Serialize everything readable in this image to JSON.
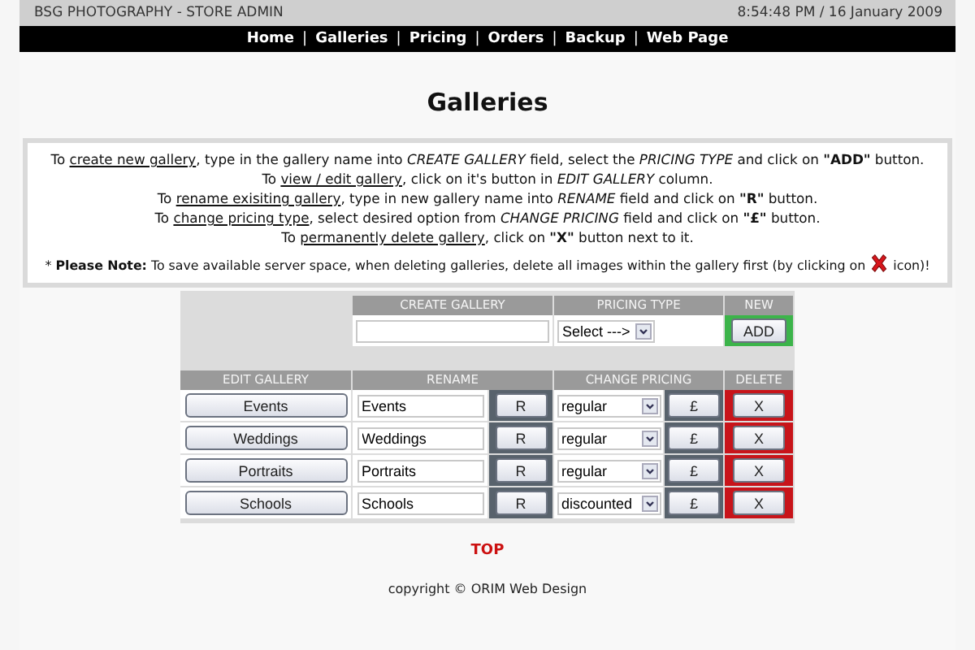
{
  "header": {
    "title": "BSG PHOTOGRAPHY - STORE ADMIN",
    "datetime": "8:54:48 PM / 16 January 2009"
  },
  "nav": [
    "Home",
    "Galleries",
    "Pricing",
    "Orders",
    "Backup",
    "Web Page"
  ],
  "nav_separator": "|",
  "page_title": "Galleries",
  "instructions": [
    {
      "kind": "line",
      "parts": [
        {
          "kind": "text",
          "text": "To "
        },
        {
          "kind": "link",
          "text": "create new gallery"
        },
        {
          "kind": "text",
          "text": ", type in the gallery name into *CREATE GALLERY* field, select the *PRICING TYPE* and click on **\"ADD\"** button."
        }
      ]
    },
    {
      "kind": "line",
      "parts": [
        {
          "kind": "text",
          "text": "To "
        },
        {
          "kind": "link",
          "text": "view / edit gallery"
        },
        {
          "kind": "text",
          "text": ", click on it's button in *EDIT GALLERY* column."
        }
      ]
    },
    {
      "kind": "line",
      "parts": [
        {
          "kind": "text",
          "text": "To "
        },
        {
          "kind": "link",
          "text": "rename exisiting gallery"
        },
        {
          "kind": "text",
          "text": ", type in new gallery name into *RENAME* field and click on **\"R\"** button."
        }
      ]
    },
    {
      "kind": "line",
      "parts": [
        {
          "kind": "text",
          "text": "To "
        },
        {
          "kind": "link",
          "text": "change pricing type"
        },
        {
          "kind": "text",
          "text": ", select desired option from *CHANGE PRICING* field and click on **\"£\"** button."
        }
      ]
    },
    {
      "kind": "line",
      "parts": [
        {
          "kind": "text",
          "text": "To "
        },
        {
          "kind": "link",
          "text": "permanently delete gallery"
        },
        {
          "kind": "text",
          "text": ", click on **\"X\"** button next to it."
        }
      ]
    },
    {
      "kind": "note",
      "parts": [
        {
          "kind": "text",
          "text": "* **Please Note:** To save available server space, when deleting galleries, delete all images within the gallery first (by clicking on "
        },
        {
          "kind": "icon"
        },
        {
          "kind": "text",
          "text": " icon)!"
        }
      ]
    }
  ],
  "create": {
    "headers": [
      "CREATE GALLERY",
      "PRICING TYPE",
      "NEW"
    ],
    "pricing_select": "Select --->",
    "add_button": "ADD"
  },
  "galleries": {
    "headers": [
      "EDIT GALLERY",
      "RENAME",
      "CHANGE PRICING",
      "DELETE"
    ],
    "rows": [
      {
        "name": "Events",
        "rename_value": "Events",
        "rename_button": "R",
        "pricing": "regular",
        "pricing_button": "£",
        "delete_button": "X"
      },
      {
        "name": "Weddings",
        "rename_value": "Weddings",
        "rename_button": "R",
        "pricing": "regular",
        "pricing_button": "£",
        "delete_button": "X"
      },
      {
        "name": "Portraits",
        "rename_value": "Portraits",
        "rename_button": "R",
        "pricing": "regular",
        "pricing_button": "£",
        "delete_button": "X"
      },
      {
        "name": "Schools",
        "rename_value": "Schools",
        "rename_button": "R",
        "pricing": "discounted",
        "pricing_button": "£",
        "delete_button": "X"
      }
    ]
  },
  "top_link": "TOP",
  "footer": "copyright © ORIM Web Design"
}
